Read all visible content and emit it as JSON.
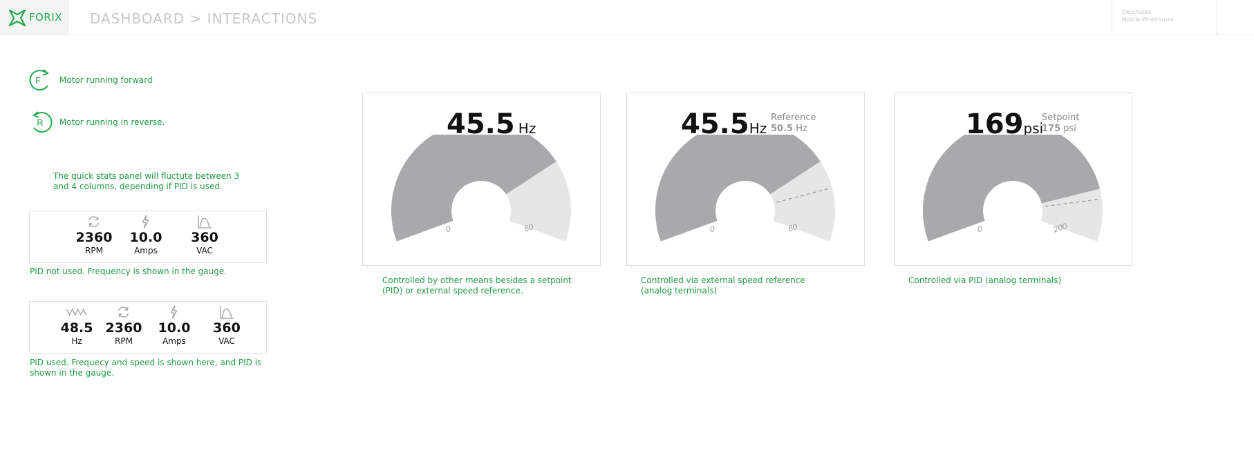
{
  "header": {
    "logo_text": "FORIX",
    "breadcrumb": "DASHBOARD > INTERACTIONS",
    "project_line1": "Deschutes",
    "project_line2": "Mobile Wireframes"
  },
  "legend": {
    "forward": {
      "letter": "F",
      "label": "Motor running forward"
    },
    "reverse": {
      "letter": "R",
      "label": "Motor running in reverse."
    }
  },
  "notes": {
    "fluctuate": "The quick stats panel will fluctute between 3 and 4 columns, depending if PID is used.",
    "pid_not_used": "PID not used. Frequency is shown in the gauge.",
    "pid_used": "PID used. Frequecy and speed is shown here, and PID  is shown in the gauge."
  },
  "stats_3col": [
    {
      "icon": "rotation-icon",
      "value": "2360",
      "unit": "RPM"
    },
    {
      "icon": "lightning-icon",
      "value": "10.0",
      "unit": "Amps"
    },
    {
      "icon": "voltage-curve-icon",
      "value": "360",
      "unit": "VAC"
    }
  ],
  "stats_4col": [
    {
      "icon": "wave-icon",
      "value": "48.5",
      "unit": "Hz"
    },
    {
      "icon": "rotation-icon",
      "value": "2360",
      "unit": "RPM"
    },
    {
      "icon": "lightning-icon",
      "value": "10.0",
      "unit": "Amps"
    },
    {
      "icon": "voltage-curve-icon",
      "value": "360",
      "unit": "VAC"
    }
  ],
  "gauges": [
    {
      "value": "45.5",
      "unit": "Hz",
      "ref_label": "",
      "ref_value": "",
      "ref_unit": "",
      "min": "0",
      "max": "60",
      "fraction": 0.758,
      "ref_fraction": null,
      "caption": "Controlled by other means besides a setpoint (PID) or external speed reference."
    },
    {
      "value": "45.5",
      "unit": "Hz",
      "ref_label": "Reference",
      "ref_value": "50.5",
      "ref_unit": "Hz",
      "min": "0",
      "max": "60",
      "fraction": 0.758,
      "ref_fraction": 0.842,
      "caption": "Controlled via external speed reference (analog terminals)"
    },
    {
      "value": "169",
      "unit": "psi",
      "ref_label": "Setpoint",
      "ref_value": "175",
      "ref_unit": "psi",
      "min": "0",
      "max": "200",
      "fraction": 0.845,
      "ref_fraction": 0.875,
      "caption": "Controlled via PID  (analog terminals)"
    }
  ],
  "colors": {
    "accent": "#22a84a",
    "gauge_fill": "#a8a9ab",
    "gauge_track": "#e6e6e7",
    "caption": "#1f9a45"
  }
}
